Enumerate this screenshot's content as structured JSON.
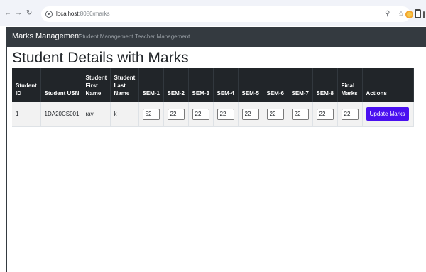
{
  "browser": {
    "back_icon": "arrow-left-icon",
    "forward_icon": "arrow-right-icon",
    "reload_icon": "reload-icon",
    "url_host": "localhost",
    "url_port": ":8080",
    "url_path": "/marks",
    "zoom_icon": "zoom-icon",
    "bookmark_icon": "star-icon"
  },
  "navbar": {
    "brand": "Marks Management",
    "links": [
      "Student Management",
      "Teacher Management"
    ]
  },
  "page": {
    "title": "Student Details with Marks"
  },
  "table": {
    "headers": {
      "id": "Student ID",
      "usn": "Student USN",
      "first": "Student First Name",
      "last": "Student Last Name",
      "sem1": "SEM-1",
      "sem2": "SEM-2",
      "sem3": "SEM-3",
      "sem4": "SEM-4",
      "sem5": "SEM-5",
      "sem6": "SEM-6",
      "sem7": "SEM-7",
      "sem8": "SEM-8",
      "final": "Final Marks",
      "actions": "Actions"
    },
    "rows": [
      {
        "id": "1",
        "usn": "1DA20CS001",
        "first": "ravi",
        "last": "k",
        "sem1": "52",
        "sem2": "22",
        "sem3": "22",
        "sem4": "22",
        "sem5": "22",
        "sem6": "22",
        "sem7": "22",
        "sem8": "22",
        "final": "22",
        "action_label": "Update Marks"
      }
    ]
  },
  "colors": {
    "navbar_bg": "#343a40",
    "table_header_bg": "#212529",
    "button_bg": "#4a10f0"
  }
}
